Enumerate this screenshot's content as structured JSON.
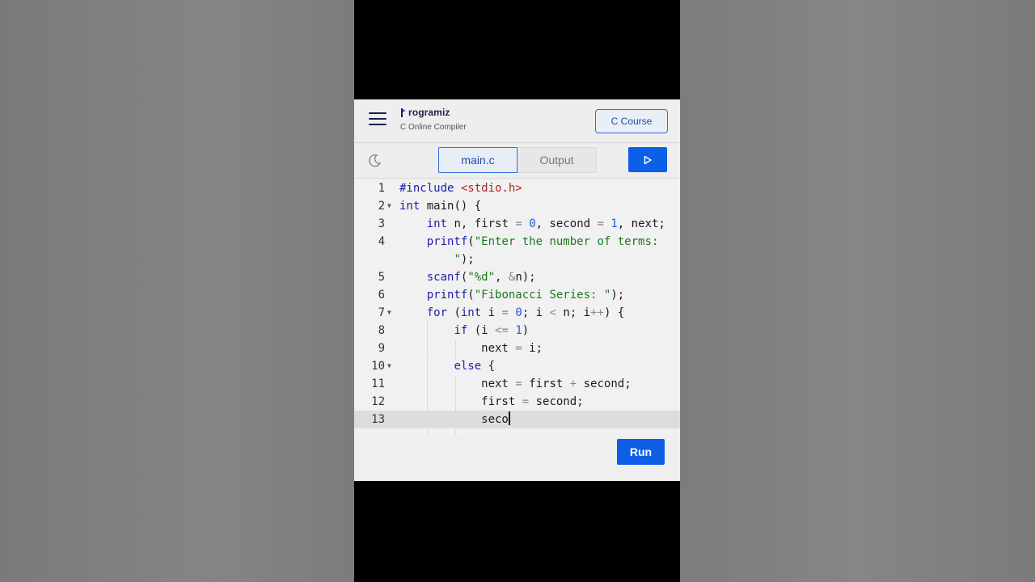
{
  "header": {
    "logo_text": "rogramiz",
    "logo_initial": "P",
    "subtitle": "C Online Compiler",
    "course_button": "C Course"
  },
  "toolbar": {
    "tab_main": "main.c",
    "tab_output": "Output",
    "theme_icon": "moon-icon",
    "run_icon": "play-icon"
  },
  "editor": {
    "line_numbers": [
      "1",
      "2",
      "3",
      "4",
      "5",
      "6",
      "7",
      "8",
      "9",
      "10",
      "11",
      "12",
      "13"
    ],
    "lines": [
      "#include <stdio.h>",
      "int main() {",
      "    int n, first = 0, second = 1, next;",
      "    printf(\"Enter the number of terms:",
      "        \");",
      "    scanf(\"%d\", &n);",
      "    printf(\"Fibonacci Series: \");",
      "    for (int i = 0; i < n; i++) {",
      "        if (i <= 1)",
      "            next = i;",
      "        else {",
      "            next = first + second;",
      "            first = second;",
      "            seco"
    ]
  },
  "run_button": "Run",
  "colors": {
    "accent": "#0d5fe8",
    "keyword": "#1e1eaa",
    "string": "#1a7a1a",
    "header": "#b0271e",
    "number": "#1f5bd6"
  }
}
